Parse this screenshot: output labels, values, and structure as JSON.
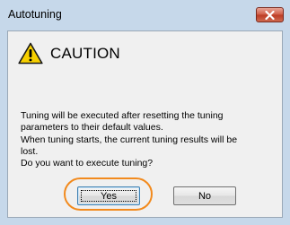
{
  "window": {
    "title": "Autotuning",
    "close_icon": "close-icon"
  },
  "dialog": {
    "icon": "warning-icon",
    "heading": "CAUTION",
    "message_lines": [
      "Tuning will be executed after resetting the tuning",
      "parameters to their default values.",
      "When tuning starts, the current tuning results will be",
      "lost.",
      "Do you want to execute tuning?"
    ],
    "buttons": {
      "yes": "Yes",
      "no": "No"
    }
  },
  "colors": {
    "highlight": "#f28a1d",
    "close_button": "#c94a33",
    "title_bar": "#c6d8ea",
    "warning_fill": "#f7d000"
  }
}
